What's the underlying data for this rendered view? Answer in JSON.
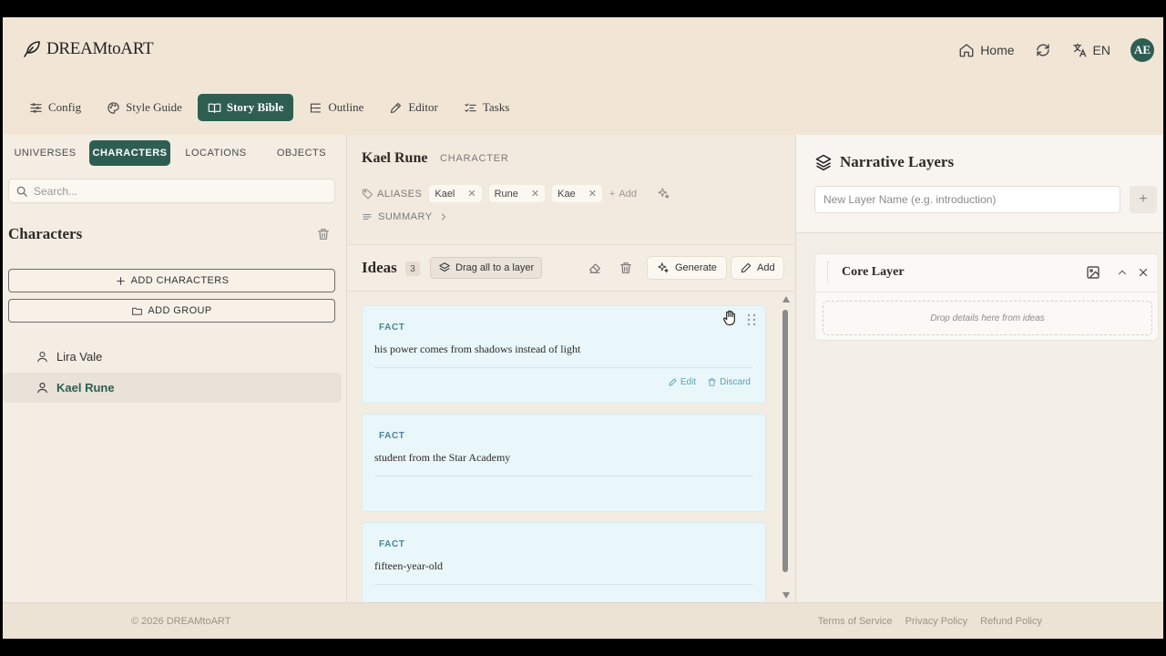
{
  "header": {
    "logo_text": "DREAMtoART",
    "home_label": "Home",
    "lang_label": "EN",
    "avatar_initials": "AE"
  },
  "nav": {
    "items": [
      {
        "label": "Config",
        "icon": "sliders-icon"
      },
      {
        "label": "Style Guide",
        "icon": "palette-icon"
      },
      {
        "label": "Story Bible",
        "icon": "book-icon",
        "active": true
      },
      {
        "label": "Outline",
        "icon": "list-tree-icon"
      },
      {
        "label": "Editor",
        "icon": "pen-icon"
      },
      {
        "label": "Tasks",
        "icon": "checklist-icon"
      }
    ]
  },
  "left": {
    "tabs": [
      "UNIVERSES",
      "CHARACTERS",
      "LOCATIONS",
      "OBJECTS"
    ],
    "active_tab": "CHARACTERS",
    "search_placeholder": "Search...",
    "section_title": "Characters",
    "add_characters_label": "ADD CHARACTERS",
    "add_group_label": "ADD GROUP",
    "characters": [
      "Lira Vale",
      "Kael Rune"
    ],
    "selected_character": "Kael Rune"
  },
  "detail": {
    "name": "Kael Rune",
    "type_tag": "CHARACTER",
    "aliases_label": "ALIASES",
    "aliases": [
      "Kael",
      "Rune",
      "Kae"
    ],
    "add_label": "Add",
    "summary_label": "SUMMARY"
  },
  "ideas": {
    "title": "Ideas",
    "count": "3",
    "drag_all_label": "Drag all to a layer",
    "generate_label": "Generate",
    "add_label": "Add",
    "edit_label": "Edit",
    "discard_label": "Discard",
    "items": [
      {
        "type": "FACT",
        "text": "his power comes from shadows instead of light"
      },
      {
        "type": "FACT",
        "text": "student from the Star Academy"
      },
      {
        "type": "FACT",
        "text": "fifteen-year-old"
      }
    ]
  },
  "layers": {
    "title": "Narrative Layers",
    "input_placeholder": "New Layer Name (e.g. introduction)",
    "add_symbol": "+",
    "items": [
      {
        "name": "Core Layer",
        "drop_hint": "Drop details here from ideas"
      }
    ]
  },
  "footer": {
    "copyright": "© 2026 DREAMtoART",
    "links": [
      "Terms of Service",
      "Privacy Policy",
      "Refund Policy"
    ]
  },
  "colors": {
    "accent": "#2e5e52",
    "card_bg": "#e9f7fa",
    "fact_label": "#4b8591"
  }
}
